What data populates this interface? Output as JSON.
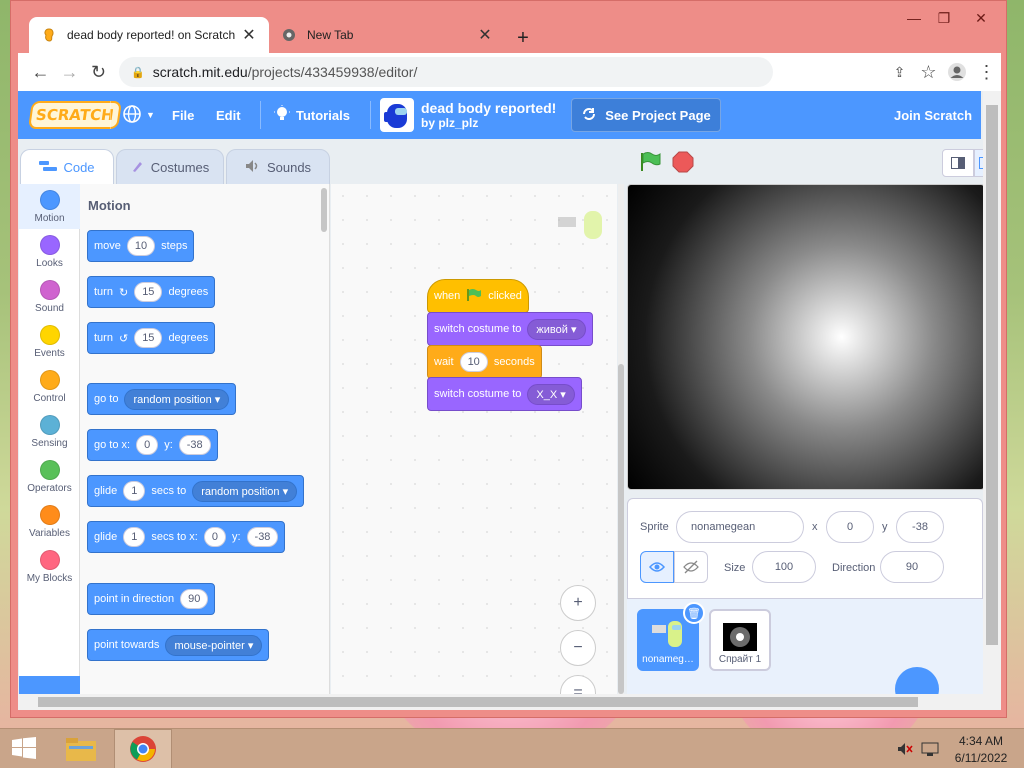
{
  "browser": {
    "tabs": [
      {
        "title": "dead body reported! on Scratch",
        "icon": "scratch-favicon"
      },
      {
        "title": "New Tab",
        "icon": "chrome-favicon"
      }
    ],
    "new_tab": "+",
    "url_host": "scratch.mit.edu",
    "url_path": "/projects/433459938/editor/",
    "window_controls": [
      "—",
      "❐",
      "✕"
    ]
  },
  "scratch": {
    "menu": {
      "logo": "SCRATCH",
      "file": "File",
      "edit": "Edit",
      "tutorials": "Tutorials",
      "project_title": "dead body reported!",
      "project_by": "by plz_plz",
      "see_project_page": "See Project Page",
      "join": "Join Scratch"
    },
    "tabs": {
      "code": "Code",
      "costumes": "Costumes",
      "sounds": "Sounds"
    },
    "categories": [
      {
        "label": "Motion",
        "color": "#4c97ff"
      },
      {
        "label": "Looks",
        "color": "#9966ff"
      },
      {
        "label": "Sound",
        "color": "#cf63cf"
      },
      {
        "label": "Events",
        "color": "#ffd500"
      },
      {
        "label": "Control",
        "color": "#ffab19"
      },
      {
        "label": "Sensing",
        "color": "#5cb1d6"
      },
      {
        "label": "Operators",
        "color": "#59c059"
      },
      {
        "label": "Variables",
        "color": "#ff8c1a"
      },
      {
        "label": "My Blocks",
        "color": "#ff6680"
      }
    ],
    "palette": {
      "heading": "Motion",
      "move": {
        "a": "move",
        "v": "10",
        "b": "steps"
      },
      "turn_cw": {
        "a": "turn",
        "v": "15",
        "b": "degrees"
      },
      "turn_ccw": {
        "a": "turn",
        "v": "15",
        "b": "degrees"
      },
      "goto": {
        "a": "go to",
        "v": "random position"
      },
      "goto_xy": {
        "a": "go to x:",
        "x": "0",
        "yl": "y:",
        "y": "-38"
      },
      "glide": {
        "a": "glide",
        "v": "1",
        "b": "secs to",
        "dd": "random position"
      },
      "glide_xy": {
        "a": "glide",
        "v": "1",
        "b": "secs to x:",
        "x": "0",
        "yl": "y:",
        "y": "-38"
      },
      "point_dir": {
        "a": "point in direction",
        "v": "90"
      },
      "point_towards": {
        "a": "point towards",
        "v": "mouse-pointer"
      }
    },
    "script": {
      "when": "when",
      "clicked": "clicked",
      "switch1": {
        "a": "switch costume to",
        "v": "живой"
      },
      "wait": {
        "a": "wait",
        "v": "10",
        "b": "seconds"
      },
      "switch2": {
        "a": "switch costume to",
        "v": "X_X"
      }
    },
    "zoom": {
      "in": "+",
      "out": "−",
      "reset": "="
    },
    "sprite_info": {
      "sprite_label": "Sprite",
      "sprite_name": "nonamegean",
      "x_label": "x",
      "x": "0",
      "y_label": "y",
      "y": "-38",
      "size_label": "Size",
      "size": "100",
      "direction_label": "Direction",
      "direction": "90"
    },
    "sprites": [
      {
        "name": "nonameg…"
      },
      {
        "name": "Спрайт 1"
      }
    ]
  },
  "taskbar": {
    "time": "4:34 AM",
    "date": "6/11/2022"
  },
  "colors": {
    "scratch_blue": "#4c97ff",
    "looks_purple": "#9966ff",
    "events_yellow": "#ffbf00",
    "control_orange": "#ffab19"
  }
}
